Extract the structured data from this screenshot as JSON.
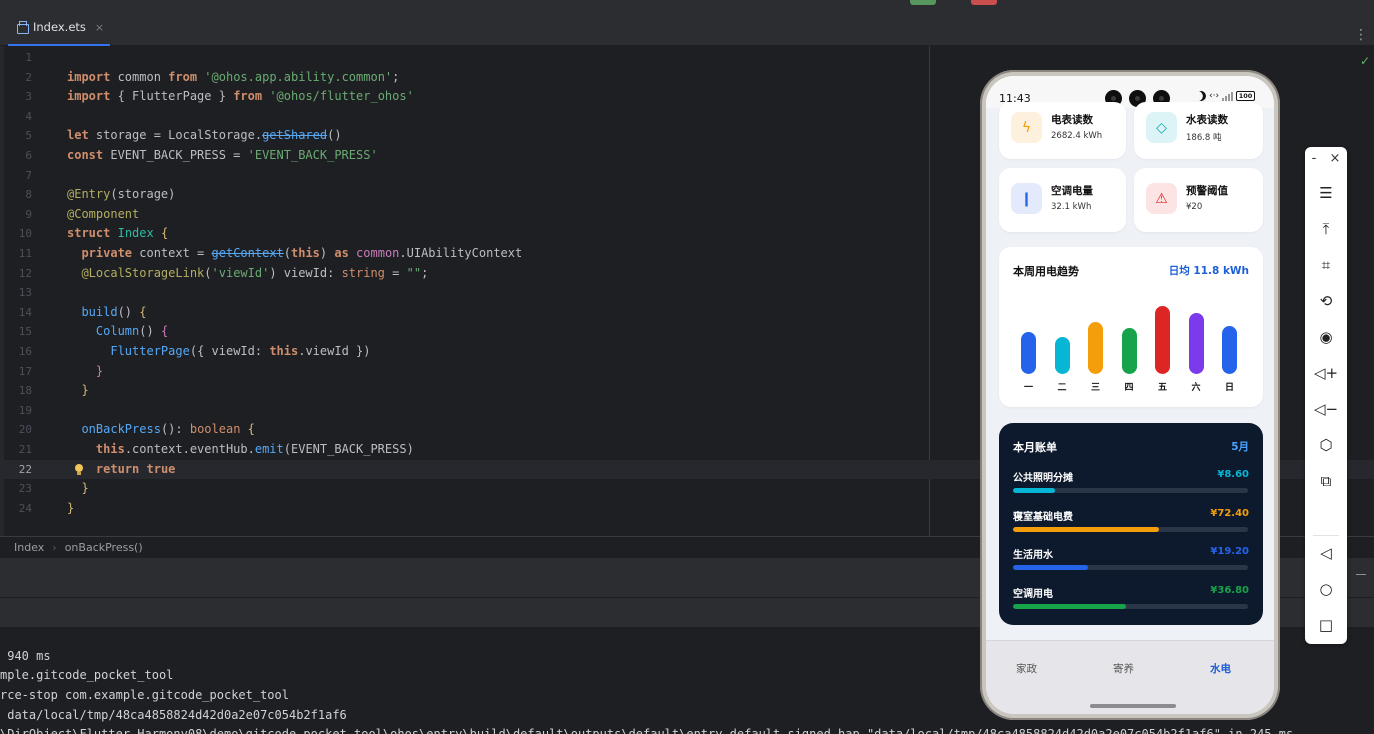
{
  "ide": {
    "tab_label": "Index.ets",
    "tab_close": "×",
    "menu_glyph": "⋮",
    "code_lines": [
      {
        "n": "1"
      },
      {
        "n": "2"
      },
      {
        "n": "3"
      },
      {
        "n": "4"
      },
      {
        "n": "5"
      },
      {
        "n": "6"
      },
      {
        "n": "7"
      },
      {
        "n": "8"
      },
      {
        "n": "9"
      },
      {
        "n": "10"
      },
      {
        "n": "11"
      },
      {
        "n": "12"
      },
      {
        "n": "13"
      },
      {
        "n": "14"
      },
      {
        "n": "15"
      },
      {
        "n": "16"
      },
      {
        "n": "17"
      },
      {
        "n": "18"
      },
      {
        "n": "19"
      },
      {
        "n": "20"
      },
      {
        "n": "21"
      },
      {
        "n": "22"
      },
      {
        "n": "23"
      },
      {
        "n": "24"
      }
    ],
    "current_line": "22",
    "breadcrumb": [
      "Index",
      "onBackPress()"
    ],
    "breadcrumb_sep": "›",
    "console_lines": [
      " 940 ms",
      "mple.gitcode_pocket_tool",
      "rce-stop com.example.gitcode_pocket_tool",
      " data/local/tmp/48ca4858824d42d0a2e07c054b2f1af6",
      "\\DirObject\\Flutter_Harmony08\\demo\\gitcode_pocket_tool\\ohos\\entry\\build\\default\\outputs\\default\\entry-default-signed.hap \"data/local/tmp/48ca4858824d42d0a2e07c054b2f1af6\" in 245 ms"
    ]
  },
  "phone": {
    "status_time": "11:43",
    "battery": "100",
    "arrows": "‹·›",
    "cards": [
      {
        "icon": "bolt-icon",
        "glyph": "ϟ",
        "title": "电表读数",
        "value": "2682.4 kWh",
        "bg": "#fdf0dc",
        "fg": "#f59e0b"
      },
      {
        "icon": "water-drop-icon",
        "glyph": "◇",
        "title": "水表读数",
        "value": "186.8 吨",
        "bg": "#ddf4f6",
        "fg": "#0ea5b7"
      },
      {
        "icon": "thermometer-icon",
        "glyph": "❙",
        "title": "空调电量",
        "value": "32.1 kWh",
        "bg": "#e3eafb",
        "fg": "#2563eb"
      },
      {
        "icon": "alarm-icon",
        "glyph": "⚠",
        "title": "预警阈值",
        "value": "¥20",
        "bg": "#fde4e4",
        "fg": "#dc2626"
      }
    ],
    "trend": {
      "title": "本周用电趋势",
      "average": "日均 11.8 kWh"
    },
    "bill": {
      "title": "本月账单",
      "month": "5月",
      "items": [
        {
          "name": "公共照明分摊",
          "amount": "¥8.60",
          "color": "#06b6d4",
          "ratio": 0.18
        },
        {
          "name": "寝室基础电费",
          "amount": "¥72.40",
          "color": "#f59e0b",
          "ratio": 0.62
        },
        {
          "name": "生活用水",
          "amount": "¥19.20",
          "color": "#2563eb",
          "ratio": 0.32
        },
        {
          "name": "空调用电",
          "amount": "¥36.80",
          "color": "#16a34a",
          "ratio": 0.48
        }
      ]
    },
    "nav": [
      "家政",
      "寄养",
      "水电"
    ],
    "nav_active": "水电"
  },
  "chart_data": {
    "type": "bar",
    "title": "本周用电趋势",
    "categories": [
      "一",
      "二",
      "三",
      "四",
      "五",
      "六",
      "日"
    ],
    "values": [
      9.5,
      8.5,
      12,
      10.5,
      15.5,
      14,
      11
    ],
    "colors": [
      "#2563eb",
      "#06b6d4",
      "#f59e0b",
      "#16a34a",
      "#dc2626",
      "#7c3aed",
      "#2563eb"
    ],
    "ylim": [
      0,
      16
    ],
    "grid": false
  },
  "emulator_toolbar": {
    "top": [
      "-",
      "×"
    ],
    "tools": [
      {
        "icon": "menu-icon",
        "glyph": "☰"
      },
      {
        "icon": "pin-top-icon",
        "glyph": "⤒"
      },
      {
        "icon": "crop-icon",
        "glyph": "⌗"
      },
      {
        "icon": "rotate-icon",
        "glyph": "⟲"
      },
      {
        "icon": "screen-record-icon",
        "glyph": "◉"
      },
      {
        "icon": "volume-up-icon",
        "glyph": "◁+"
      },
      {
        "icon": "volume-down-icon",
        "glyph": "◁−"
      },
      {
        "icon": "rotate-device-icon",
        "glyph": "⬡"
      },
      {
        "icon": "multi-window-icon",
        "glyph": "⧉"
      }
    ],
    "nav": [
      {
        "icon": "back-icon",
        "glyph": "◁"
      },
      {
        "icon": "home-icon",
        "glyph": "○"
      },
      {
        "icon": "recents-icon",
        "glyph": "□"
      }
    ]
  }
}
